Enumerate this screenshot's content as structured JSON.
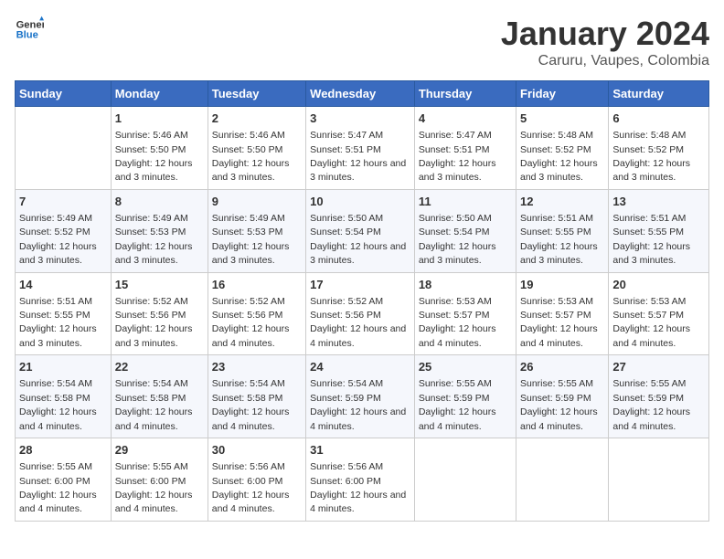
{
  "header": {
    "logo_line1": "General",
    "logo_line2": "Blue",
    "title": "January 2024",
    "subtitle": "Caruru, Vaupes, Colombia"
  },
  "calendar": {
    "weekdays": [
      "Sunday",
      "Monday",
      "Tuesday",
      "Wednesday",
      "Thursday",
      "Friday",
      "Saturday"
    ],
    "weeks": [
      [
        {
          "day": "",
          "sunrise": "",
          "sunset": "",
          "daylight": ""
        },
        {
          "day": "1",
          "sunrise": "Sunrise: 5:46 AM",
          "sunset": "Sunset: 5:50 PM",
          "daylight": "Daylight: 12 hours and 3 minutes."
        },
        {
          "day": "2",
          "sunrise": "Sunrise: 5:46 AM",
          "sunset": "Sunset: 5:50 PM",
          "daylight": "Daylight: 12 hours and 3 minutes."
        },
        {
          "day": "3",
          "sunrise": "Sunrise: 5:47 AM",
          "sunset": "Sunset: 5:51 PM",
          "daylight": "Daylight: 12 hours and 3 minutes."
        },
        {
          "day": "4",
          "sunrise": "Sunrise: 5:47 AM",
          "sunset": "Sunset: 5:51 PM",
          "daylight": "Daylight: 12 hours and 3 minutes."
        },
        {
          "day": "5",
          "sunrise": "Sunrise: 5:48 AM",
          "sunset": "Sunset: 5:52 PM",
          "daylight": "Daylight: 12 hours and 3 minutes."
        },
        {
          "day": "6",
          "sunrise": "Sunrise: 5:48 AM",
          "sunset": "Sunset: 5:52 PM",
          "daylight": "Daylight: 12 hours and 3 minutes."
        }
      ],
      [
        {
          "day": "7",
          "sunrise": "Sunrise: 5:49 AM",
          "sunset": "Sunset: 5:52 PM",
          "daylight": "Daylight: 12 hours and 3 minutes."
        },
        {
          "day": "8",
          "sunrise": "Sunrise: 5:49 AM",
          "sunset": "Sunset: 5:53 PM",
          "daylight": "Daylight: 12 hours and 3 minutes."
        },
        {
          "day": "9",
          "sunrise": "Sunrise: 5:49 AM",
          "sunset": "Sunset: 5:53 PM",
          "daylight": "Daylight: 12 hours and 3 minutes."
        },
        {
          "day": "10",
          "sunrise": "Sunrise: 5:50 AM",
          "sunset": "Sunset: 5:54 PM",
          "daylight": "Daylight: 12 hours and 3 minutes."
        },
        {
          "day": "11",
          "sunrise": "Sunrise: 5:50 AM",
          "sunset": "Sunset: 5:54 PM",
          "daylight": "Daylight: 12 hours and 3 minutes."
        },
        {
          "day": "12",
          "sunrise": "Sunrise: 5:51 AM",
          "sunset": "Sunset: 5:55 PM",
          "daylight": "Daylight: 12 hours and 3 minutes."
        },
        {
          "day": "13",
          "sunrise": "Sunrise: 5:51 AM",
          "sunset": "Sunset: 5:55 PM",
          "daylight": "Daylight: 12 hours and 3 minutes."
        }
      ],
      [
        {
          "day": "14",
          "sunrise": "Sunrise: 5:51 AM",
          "sunset": "Sunset: 5:55 PM",
          "daylight": "Daylight: 12 hours and 3 minutes."
        },
        {
          "day": "15",
          "sunrise": "Sunrise: 5:52 AM",
          "sunset": "Sunset: 5:56 PM",
          "daylight": "Daylight: 12 hours and 3 minutes."
        },
        {
          "day": "16",
          "sunrise": "Sunrise: 5:52 AM",
          "sunset": "Sunset: 5:56 PM",
          "daylight": "Daylight: 12 hours and 4 minutes."
        },
        {
          "day": "17",
          "sunrise": "Sunrise: 5:52 AM",
          "sunset": "Sunset: 5:56 PM",
          "daylight": "Daylight: 12 hours and 4 minutes."
        },
        {
          "day": "18",
          "sunrise": "Sunrise: 5:53 AM",
          "sunset": "Sunset: 5:57 PM",
          "daylight": "Daylight: 12 hours and 4 minutes."
        },
        {
          "day": "19",
          "sunrise": "Sunrise: 5:53 AM",
          "sunset": "Sunset: 5:57 PM",
          "daylight": "Daylight: 12 hours and 4 minutes."
        },
        {
          "day": "20",
          "sunrise": "Sunrise: 5:53 AM",
          "sunset": "Sunset: 5:57 PM",
          "daylight": "Daylight: 12 hours and 4 minutes."
        }
      ],
      [
        {
          "day": "21",
          "sunrise": "Sunrise: 5:54 AM",
          "sunset": "Sunset: 5:58 PM",
          "daylight": "Daylight: 12 hours and 4 minutes."
        },
        {
          "day": "22",
          "sunrise": "Sunrise: 5:54 AM",
          "sunset": "Sunset: 5:58 PM",
          "daylight": "Daylight: 12 hours and 4 minutes."
        },
        {
          "day": "23",
          "sunrise": "Sunrise: 5:54 AM",
          "sunset": "Sunset: 5:58 PM",
          "daylight": "Daylight: 12 hours and 4 minutes."
        },
        {
          "day": "24",
          "sunrise": "Sunrise: 5:54 AM",
          "sunset": "Sunset: 5:59 PM",
          "daylight": "Daylight: 12 hours and 4 minutes."
        },
        {
          "day": "25",
          "sunrise": "Sunrise: 5:55 AM",
          "sunset": "Sunset: 5:59 PM",
          "daylight": "Daylight: 12 hours and 4 minutes."
        },
        {
          "day": "26",
          "sunrise": "Sunrise: 5:55 AM",
          "sunset": "Sunset: 5:59 PM",
          "daylight": "Daylight: 12 hours and 4 minutes."
        },
        {
          "day": "27",
          "sunrise": "Sunrise: 5:55 AM",
          "sunset": "Sunset: 5:59 PM",
          "daylight": "Daylight: 12 hours and 4 minutes."
        }
      ],
      [
        {
          "day": "28",
          "sunrise": "Sunrise: 5:55 AM",
          "sunset": "Sunset: 6:00 PM",
          "daylight": "Daylight: 12 hours and 4 minutes."
        },
        {
          "day": "29",
          "sunrise": "Sunrise: 5:55 AM",
          "sunset": "Sunset: 6:00 PM",
          "daylight": "Daylight: 12 hours and 4 minutes."
        },
        {
          "day": "30",
          "sunrise": "Sunrise: 5:56 AM",
          "sunset": "Sunset: 6:00 PM",
          "daylight": "Daylight: 12 hours and 4 minutes."
        },
        {
          "day": "31",
          "sunrise": "Sunrise: 5:56 AM",
          "sunset": "Sunset: 6:00 PM",
          "daylight": "Daylight: 12 hours and 4 minutes."
        },
        {
          "day": "",
          "sunrise": "",
          "sunset": "",
          "daylight": ""
        },
        {
          "day": "",
          "sunrise": "",
          "sunset": "",
          "daylight": ""
        },
        {
          "day": "",
          "sunrise": "",
          "sunset": "",
          "daylight": ""
        }
      ]
    ]
  }
}
